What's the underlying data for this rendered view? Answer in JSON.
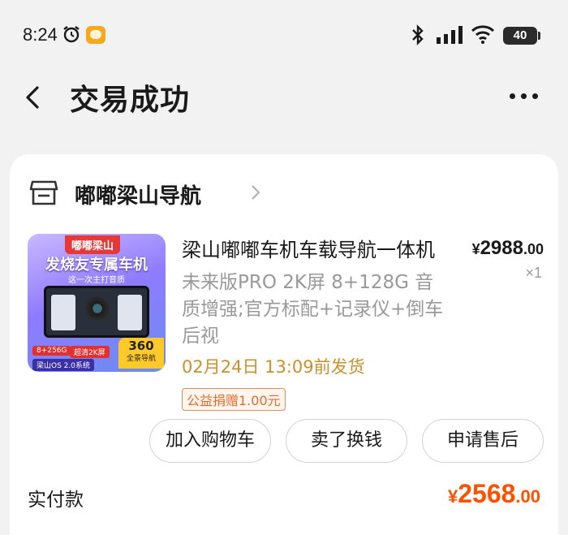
{
  "status_bar": {
    "time": "8:24",
    "battery": "40"
  },
  "header": {
    "title": "交易成功"
  },
  "store": {
    "name": "嘟嘟梁山导航"
  },
  "product": {
    "title": "梁山嘟嘟车机车载导航一体机",
    "price_symbol": "¥",
    "price_int": "2988",
    "price_dec": ".00",
    "quantity": "×1",
    "spec": "未来版PRO 2K屏 8+128G 音质增强;官方标配+记录仪+倒车后视",
    "ship_time": "02月24日 13:09前发货",
    "charity_tag": "公益捐赠1.00元",
    "thumbnail": {
      "brand": "嘟嘟梁山",
      "headline": "发烧友专属车机",
      "sub": "这一次主打音质",
      "badge_storage": "8+256G",
      "badge_screen": "超清2K屏",
      "os": "梁山OS 2.0系统",
      "badge_360_num": "360",
      "badge_360_text": "全景导航"
    }
  },
  "actions": {
    "add_cart": "加入购物车",
    "resell": "卖了换钱",
    "after_sale": "申请售后"
  },
  "payment": {
    "label": "实付款",
    "symbol": "¥",
    "amount_int": "2568",
    "amount_dec": ".00"
  },
  "colors": {
    "accent_orange": "#ff5000",
    "ship_gold": "#c9902c",
    "page_bg": "#f2f2f2"
  }
}
